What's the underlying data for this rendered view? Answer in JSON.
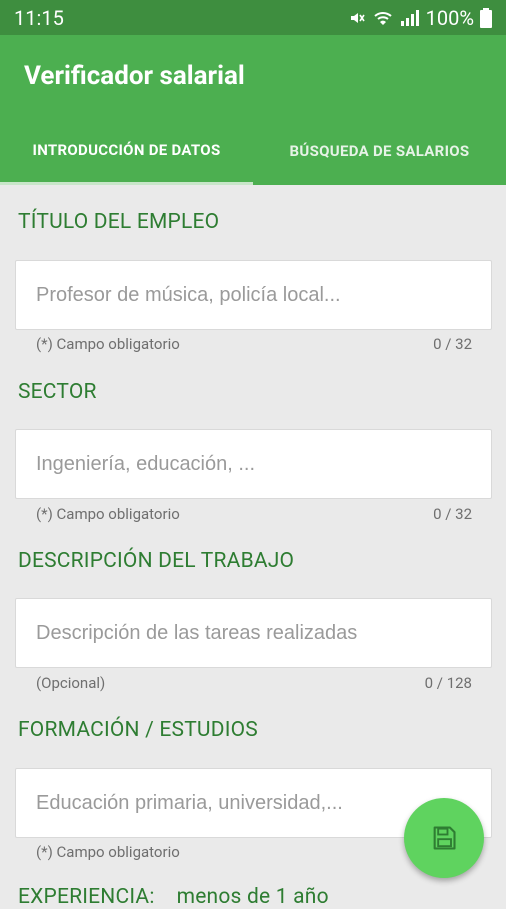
{
  "status_bar": {
    "time": "11:15",
    "battery": "100%"
  },
  "app_bar": {
    "title": "Verificador salarial",
    "tabs": [
      {
        "label": "INTRODUCCIÓN DE DATOS",
        "active": true
      },
      {
        "label": "BÚSQUEDA DE SALARIOS",
        "active": false
      }
    ]
  },
  "form": {
    "job_title": {
      "label": "TÍTULO DEL EMPLEO",
      "placeholder": "Profesor de música, policía local...",
      "helper": "(*) Campo obligatorio",
      "counter": "0 / 32"
    },
    "sector": {
      "label": "SECTOR",
      "placeholder": "Ingeniería, educación, ...",
      "helper": "(*) Campo obligatorio",
      "counter": "0 / 32"
    },
    "description": {
      "label": "DESCRIPCIÓN DEL TRABAJO",
      "placeholder": "Descripción de las tareas realizadas",
      "helper": "(Opcional)",
      "counter": "0 / 128"
    },
    "education": {
      "label": "FORMACIÓN / ESTUDIOS",
      "placeholder": "Educación primaria, universidad,...",
      "helper": "(*) Campo obligatorio"
    },
    "experience": {
      "label": "EXPERIENCIA:",
      "value": "menos de 1 año"
    }
  },
  "colors": {
    "status_bar": "#3e8e3f",
    "app_bar": "#4caf50",
    "fab": "#5fd35f",
    "section_label": "#2e7d32",
    "background": "#eaeaea"
  },
  "icons": {
    "fab": "save-icon",
    "wifi": "wifi-icon",
    "signal": "signal-icon",
    "battery": "battery-icon",
    "mute": "mute-icon"
  }
}
